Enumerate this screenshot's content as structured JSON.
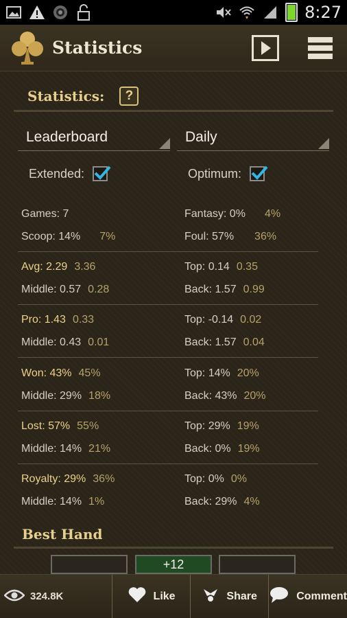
{
  "status_bar": {
    "time": "8:27",
    "icons": [
      "image-icon",
      "warning-icon",
      "app-icon",
      "unlock-icon",
      "mute-icon",
      "wifi-icon",
      "signal-icon",
      "battery-icon"
    ]
  },
  "app_bar": {
    "title": "Statistics",
    "logo": "club-logo-icon",
    "actions": [
      "play-icon",
      "menu-icon"
    ]
  },
  "section": {
    "title": "Statistics:",
    "help_label": "?"
  },
  "filters": {
    "left_dropdown": "Leaderboard",
    "right_dropdown": "Daily",
    "extended_label": "Extended:",
    "extended_checked": true,
    "optimum_label": "Optimum:",
    "optimum_checked": true
  },
  "stats": {
    "games": "Games: 7",
    "fantasy": "Fantasy: 0%",
    "fantasy_opt": "4%",
    "scoop": "Scoop: 14%",
    "scoop_opt": "7%",
    "foul": "Foul: 57%",
    "foul_opt": "36%",
    "avg": "Avg: 2.29",
    "avg_opt": "3.36",
    "avg_top": "Top: 0.14",
    "avg_top_opt": "0.35",
    "avg_middle": "Middle: 0.57",
    "avg_middle_opt": "0.28",
    "avg_back": "Back: 1.57",
    "avg_back_opt": "0.99",
    "pro": "Pro: 1.43",
    "pro_opt": "0.33",
    "pro_top": "Top: -0.14",
    "pro_top_opt": "0.02",
    "pro_middle": "Middle: 0.43",
    "pro_middle_opt": "0.01",
    "pro_back": "Back: 1.57",
    "pro_back_opt": "0.04",
    "won": "Won: 43%",
    "won_opt": "45%",
    "won_top": "Top: 14%",
    "won_top_opt": "20%",
    "won_middle": "Middle: 29%",
    "won_middle_opt": "18%",
    "won_back": "Back: 43%",
    "won_back_opt": "20%",
    "lost": "Lost: 57%",
    "lost_opt": "55%",
    "lost_top": "Top: 29%",
    "lost_top_opt": "19%",
    "lost_middle": "Middle: 14%",
    "lost_middle_opt": "21%",
    "lost_back": "Back: 0%",
    "lost_back_opt": "19%",
    "royalty": "Royalty: 29%",
    "royalty_opt": "36%",
    "royalty_top": "Top: 0%",
    "royalty_top_opt": "0%",
    "royalty_middle": "Middle: 14%",
    "royalty_middle_opt": "1%",
    "royalty_back": "Back: 29%",
    "royalty_back_opt": "4%"
  },
  "best_hand": {
    "title": "Best Hand",
    "left": "",
    "middle": "+12",
    "right": ""
  },
  "bottom_bar": {
    "views": "324.8K",
    "like": "Like",
    "share": "Share",
    "comment": "Comment"
  },
  "colors": {
    "background": "#2b2519",
    "accent_gold": "#e7cf8e",
    "secondary_value": "#b6a26b",
    "checkbox_blue": "#33b5e5",
    "best_hand_green": "#1f4a22"
  }
}
